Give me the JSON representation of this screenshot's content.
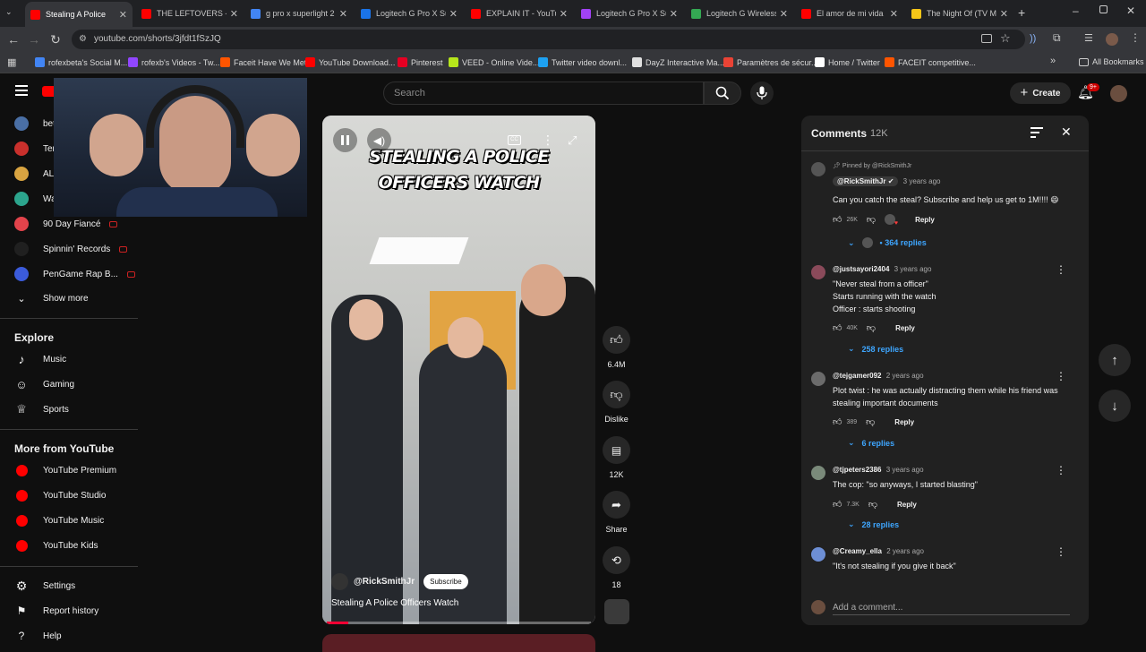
{
  "browser": {
    "tabs": [
      {
        "title": "Stealing A Police",
        "favicon_color": "#ff0000",
        "active": true
      },
      {
        "title": "THE LEFTOVERS - Se",
        "favicon_color": "#ff0000"
      },
      {
        "title": "g pro x superlight 2",
        "favicon_color": "#4285f4"
      },
      {
        "title": "Logitech G Pro X Sup",
        "favicon_color": "#1a73e8"
      },
      {
        "title": "EXPLAIN IT - YouTub",
        "favicon_color": "#ff0000"
      },
      {
        "title": "Logitech G Pro X Sup",
        "favicon_color": "#a142f4"
      },
      {
        "title": "Logitech G Wireless",
        "favicon_color": "#34a853"
      },
      {
        "title": "El amor de mi vida",
        "favicon_color": "#ff0000"
      },
      {
        "title": "The Night Of (TV Mi",
        "favicon_color": "#f5c518"
      }
    ],
    "url": "youtube.com/shorts/3jfdt1fSzJQ",
    "bookmarks": [
      {
        "label": "rofexbeta's Social M...",
        "color": "#4285f4"
      },
      {
        "label": "rofexb's Videos - Tw...",
        "color": "#9146ff"
      },
      {
        "label": "Faceit Have We Met",
        "color": "#ff5500"
      },
      {
        "label": "YouTube Download...",
        "color": "#ff0000"
      },
      {
        "label": "Pinterest",
        "color": "#e60023"
      },
      {
        "label": "VEED - Online Vide...",
        "color": "#b6e61b"
      },
      {
        "label": "Twitter video downl...",
        "color": "#1da1f2"
      },
      {
        "label": "DayZ Interactive Ma...",
        "color": "#e0e0e0"
      },
      {
        "label": "Paramètres de sécur...",
        "color": "#ea4335"
      },
      {
        "label": "Home / Twitter",
        "color": "#ffffff"
      },
      {
        "label": "FACEIT competitive...",
        "color": "#ff5500"
      }
    ],
    "all_bookmarks": "All Bookmarks"
  },
  "header": {
    "search_placeholder": "Search",
    "create_label": "Create",
    "notifications_badge": "9+"
  },
  "sidebar": {
    "subscriptions": [
      {
        "label": "bet",
        "color": "#4a6fa5"
      },
      {
        "label": "Ter",
        "color": "#c9302c"
      },
      {
        "label": "AL",
        "color": "#d9a441"
      },
      {
        "label": "Wa",
        "color": "#2ca58d"
      },
      {
        "label": "90 Day Fiancé",
        "color": "#e2434b"
      },
      {
        "label": "Spinnin' Records",
        "color": "#202020"
      },
      {
        "label": "PenGame Rap B...",
        "color": "#3b5bdb"
      }
    ],
    "show_more": "Show more",
    "explore_heading": "Explore",
    "explore": [
      {
        "label": "Music",
        "icon": "music-note-icon"
      },
      {
        "label": "Gaming",
        "icon": "gaming-icon"
      },
      {
        "label": "Sports",
        "icon": "trophy-icon"
      }
    ],
    "more_heading": "More from YouTube",
    "more": [
      {
        "label": "YouTube Premium"
      },
      {
        "label": "YouTube Studio"
      },
      {
        "label": "YouTube Music"
      },
      {
        "label": "YouTube Kids"
      }
    ],
    "settings": "Settings",
    "report_history": "Report history",
    "help": "Help"
  },
  "short": {
    "caption_line1": "STEALING A POLICE",
    "caption_line2": "OFFICERS WATCH",
    "channel": "@RickSmithJr",
    "subscribe": "Subscribe",
    "title": "Stealing A Police Officers Watch",
    "progress_fraction": 0.08,
    "actions": {
      "likes": "6.4M",
      "dislike": "Dislike",
      "comments": "12K",
      "share": "Share",
      "remix": "18"
    }
  },
  "comments": {
    "title": "Comments",
    "count": "12K",
    "add_placeholder": "Add a comment...",
    "items": [
      {
        "pinned": "Pinned by @RickSmithJr",
        "author": "@RickSmithJr",
        "time": "3 years ago",
        "lines": [
          "Can you catch the steal? Subscribe and help us get to 1M!!!! 😄"
        ],
        "likes": "26K",
        "replies": "364 replies",
        "avatar_color": "#555555"
      },
      {
        "author": "@justsayori2404",
        "time": "3 years ago",
        "lines": [
          "\"Never steal from a officer\"",
          "Starts running with the watch",
          "Officer : starts shooting"
        ],
        "likes": "40K",
        "replies": "258 replies",
        "avatar_color": "#8a4a5a"
      },
      {
        "author": "@tejgamer092",
        "time": "2 years ago",
        "lines": [
          "Plot twist : he was actually distracting them while his friend was stealing important documents"
        ],
        "likes": "389",
        "replies": "6 replies",
        "avatar_color": "#6b6b6b"
      },
      {
        "author": "@tjpeters2386",
        "time": "3 years ago",
        "lines": [
          "The cop: \"so anyways, I started blasting\""
        ],
        "likes": "7.3K",
        "replies": "28 replies",
        "avatar_color": "#7a8a7a"
      },
      {
        "author": "@Creamy_ella",
        "time": "2 years ago",
        "lines": [
          "\"It's not stealing if you give it back\""
        ],
        "avatar_color": "#6d8fd6"
      }
    ],
    "reply_label": "Reply"
  }
}
